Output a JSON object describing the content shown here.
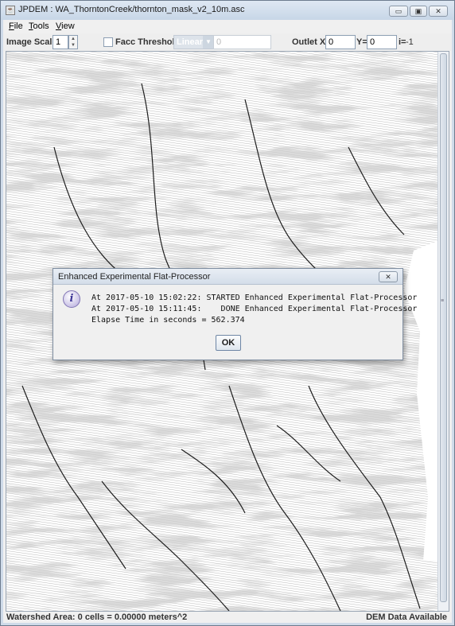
{
  "window": {
    "title": "JPDEM : WA_ThorntonCreek/thornton_mask_v2_10m.asc",
    "buttons": {
      "minimize": "▭",
      "maximize": "▣",
      "close": "✕"
    }
  },
  "menubar": {
    "items": [
      {
        "mnemonic": "F",
        "rest": "ile"
      },
      {
        "mnemonic": "T",
        "rest": "ools"
      },
      {
        "mnemonic": "V",
        "rest": "iew"
      }
    ]
  },
  "toolbar": {
    "image_scale_label": "Image Scale",
    "image_scale_value": "1",
    "facc_threshold_label": "Facc Threshold",
    "facc_threshold_checked": false,
    "scale_type_value": "Linear",
    "threshold_value": "0",
    "outlet_x_label": "Outlet X=",
    "outlet_x_value": "0",
    "outlet_y_label": "Y=",
    "outlet_y_value": "0",
    "index_label": "i=",
    "index_value": "-1"
  },
  "status": {
    "left": "Watershed Area: 0 cells = 0.00000 meters^2",
    "right": "DEM Data Available"
  },
  "dialog": {
    "title": "Enhanced Experimental Flat-Processor",
    "icon": "info-icon",
    "lines": [
      "At 2017-05-10 15:02:22: STARTED Enhanced Experimental Flat-Processor",
      "At 2017-05-10 15:11:45:    DONE Enhanced Experimental Flat-Processor",
      "Elapse Time in seconds = 562.374"
    ],
    "ok_label": "OK"
  }
}
